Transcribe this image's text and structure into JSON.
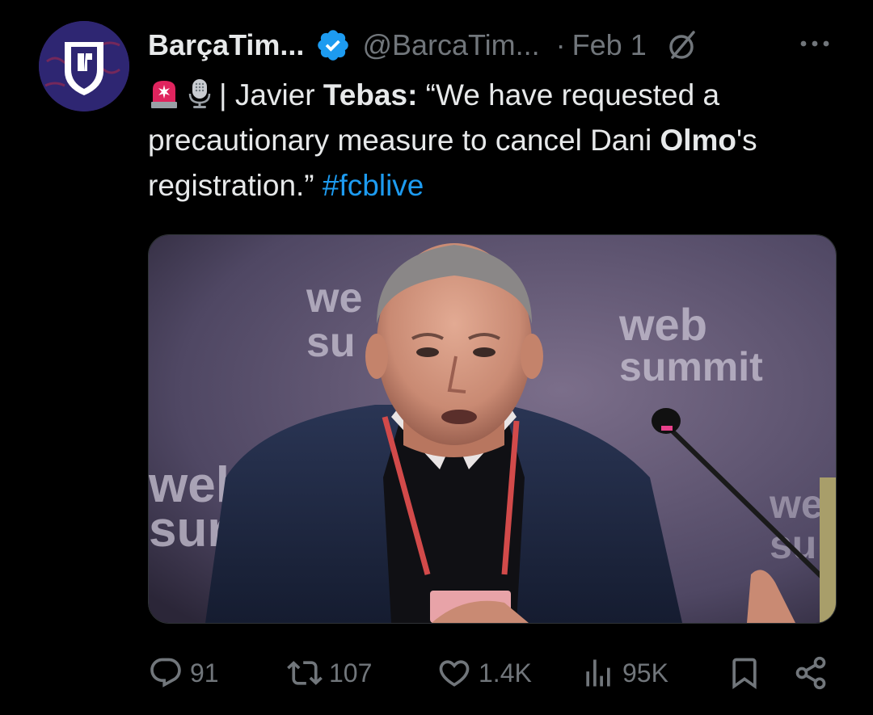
{
  "tweet": {
    "display_name": "BarçaTim...",
    "handle": "@BarcaTim...",
    "separator": "·",
    "date": "Feb 1",
    "text": {
      "prefix": "| Javier ",
      "bold_name": "Tebas",
      "colon": ":",
      "quote": " “We have requested a precautionary measure to cancel Dani ",
      "bold_olmo": "Olmo",
      "suffix": "'s registration.” ",
      "hashtag": "#fcblive"
    },
    "emojis": [
      "siren-emoji",
      "microphone-emoji"
    ],
    "stats": {
      "replies": "91",
      "reposts": "107",
      "likes": "1.4K",
      "views": "95K"
    },
    "colors": {
      "background": "#000000",
      "text": "#e7e9ea",
      "muted": "#71767b",
      "link": "#1d9bf0",
      "verified": "#1d9bf0"
    },
    "icons": {
      "verified": "verified-badge-icon",
      "grok": "grok-icon",
      "more": "more-icon",
      "reply": "reply-icon",
      "repost": "repost-icon",
      "like": "heart-icon",
      "views": "views-icon",
      "bookmark": "bookmark-icon",
      "share": "share-icon"
    }
  }
}
